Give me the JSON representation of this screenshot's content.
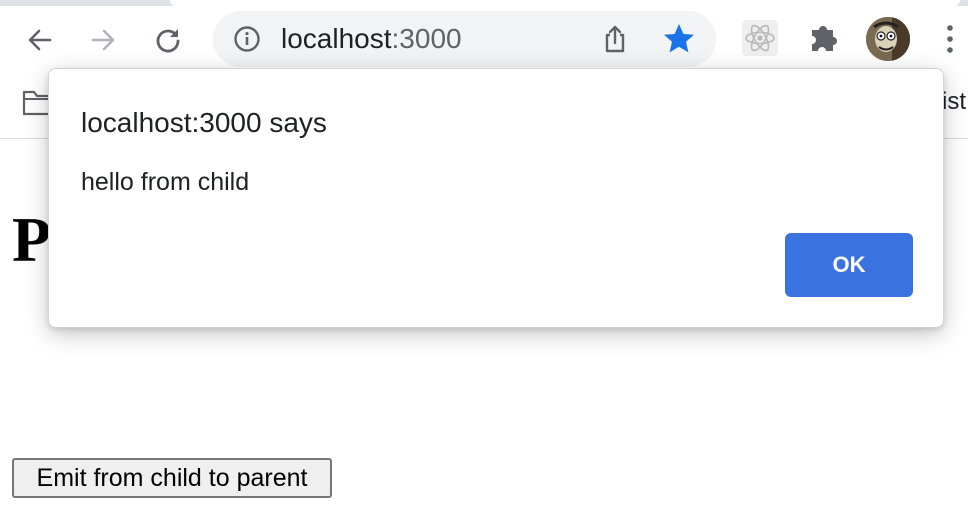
{
  "browser": {
    "address_host": "localhost",
    "address_port": ":3000",
    "bookmarks_cut_text": "ist"
  },
  "page": {
    "heading": "Parent",
    "emit_button_label": "Emit from child to parent"
  },
  "dialog": {
    "title": "localhost:3000 says",
    "message": "hello from child",
    "ok_label": "OK"
  },
  "icons": {
    "back": "arrow-left-icon",
    "forward": "arrow-right-icon",
    "reload": "reload-icon",
    "info": "info-icon",
    "share": "share-icon",
    "bookmark": "star-icon",
    "react_devtools": "react-icon",
    "extensions": "puzzle-icon",
    "menu": "three-dots-icon",
    "folder": "folder-icon"
  },
  "colors": {
    "accent": "#3a73e0",
    "star": "#1a73e8",
    "omnibox_bg": "#f1f3f4"
  }
}
